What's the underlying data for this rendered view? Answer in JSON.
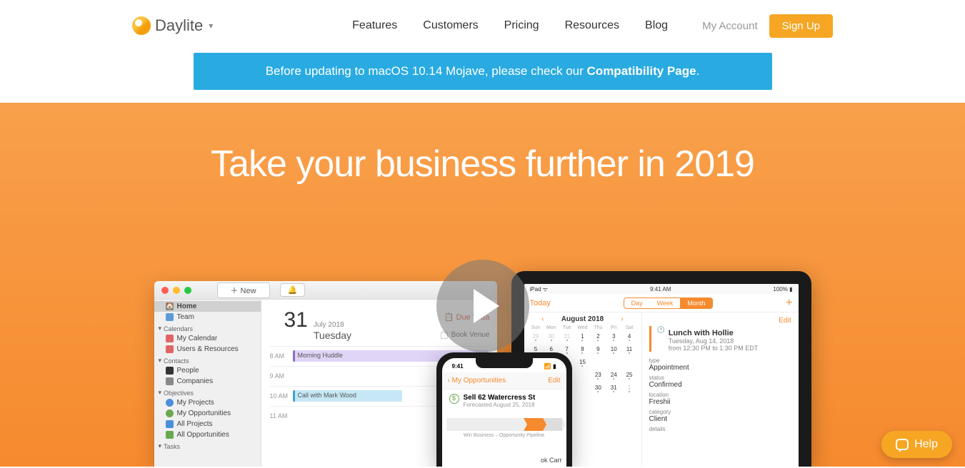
{
  "brand": {
    "name": "Daylite"
  },
  "nav": {
    "features": "Features",
    "customers": "Customers",
    "pricing": "Pricing",
    "resources": "Resources",
    "blog": "Blog"
  },
  "account": {
    "my_account": "My Account",
    "signup": "Sign Up"
  },
  "banner": {
    "prefix": "Before updating to macOS 10.14 Mojave, please check our ",
    "link": "Compatibility Page",
    "suffix": "."
  },
  "hero": {
    "headline": "Take your business further in 2019"
  },
  "mac": {
    "new_label": "＋  New",
    "bell": "🔔",
    "sidebar": {
      "home": "Home",
      "team": "Team",
      "calendars_head": "Calendars",
      "my_calendar": "My Calendar",
      "users_resources": "Users & Resources",
      "contacts_head": "Contacts",
      "people": "People",
      "companies": "Companies",
      "objectives_head": "Objectives",
      "my_projects": "My Projects",
      "my_opportunities": "My Opportunities",
      "all_projects": "All Projects",
      "all_opportunities": "All Opportunities",
      "tasks_head": "Tasks"
    },
    "date": {
      "day": "31",
      "month": "July 2018",
      "weekday": "Tuesday"
    },
    "due_today": "Due Toda",
    "book_venue": "Book Venue",
    "times": {
      "t8": "8 AM",
      "t9": "9 AM",
      "t10": "10 AM",
      "t11": "11 AM"
    },
    "events": {
      "morning_huddle": "Morning Huddle",
      "call_mark": "Call with Mark Wood"
    }
  },
  "ipad": {
    "status": {
      "left": "iPad ᯤ",
      "time": "9:41 AM",
      "right": "100% ▮"
    },
    "today": "Today",
    "seg": {
      "day": "Day",
      "week": "Week",
      "month": "Month"
    },
    "edit": "Edit",
    "cal": {
      "month": "August 2018",
      "dows": [
        "Sun",
        "Mon",
        "Tue",
        "Wed",
        "Thu",
        "Fri",
        "Sat"
      ],
      "rows": [
        [
          "29",
          "30",
          "31",
          "1",
          "2",
          "3",
          "4"
        ],
        [
          "5",
          "6",
          "7",
          "8",
          "9",
          "10",
          "11"
        ],
        [
          "",
          "",
          "",
          "15",
          "",
          "",
          ""
        ],
        [
          "",
          "",
          "",
          "",
          "23",
          "24",
          "25"
        ],
        [
          "",
          "",
          "",
          "",
          "30",
          "31",
          "1"
        ]
      ]
    },
    "event": {
      "title": "Lunch with Hollie",
      "date": "Tuesday, Aug 14, 2018",
      "time": "from 12:30 PM to 1:30 PM EDT",
      "type_label": "type",
      "type": "Appointment",
      "status_label": "status",
      "status": "Confirmed",
      "location_label": "location",
      "location": "Freshii",
      "category_label": "category",
      "category": "Client",
      "details_label": "details"
    }
  },
  "iphone": {
    "status_time": "9:41",
    "back": "‹ My Opportunities",
    "edit": "Edit",
    "card_title": "Sell 62 Watercress St",
    "card_sub": "Forecasted August 25, 2018",
    "pipeline_label": "Win Business – Opportunity Pipeline",
    "carr": "ok Carr"
  },
  "help": {
    "label": "Help"
  }
}
